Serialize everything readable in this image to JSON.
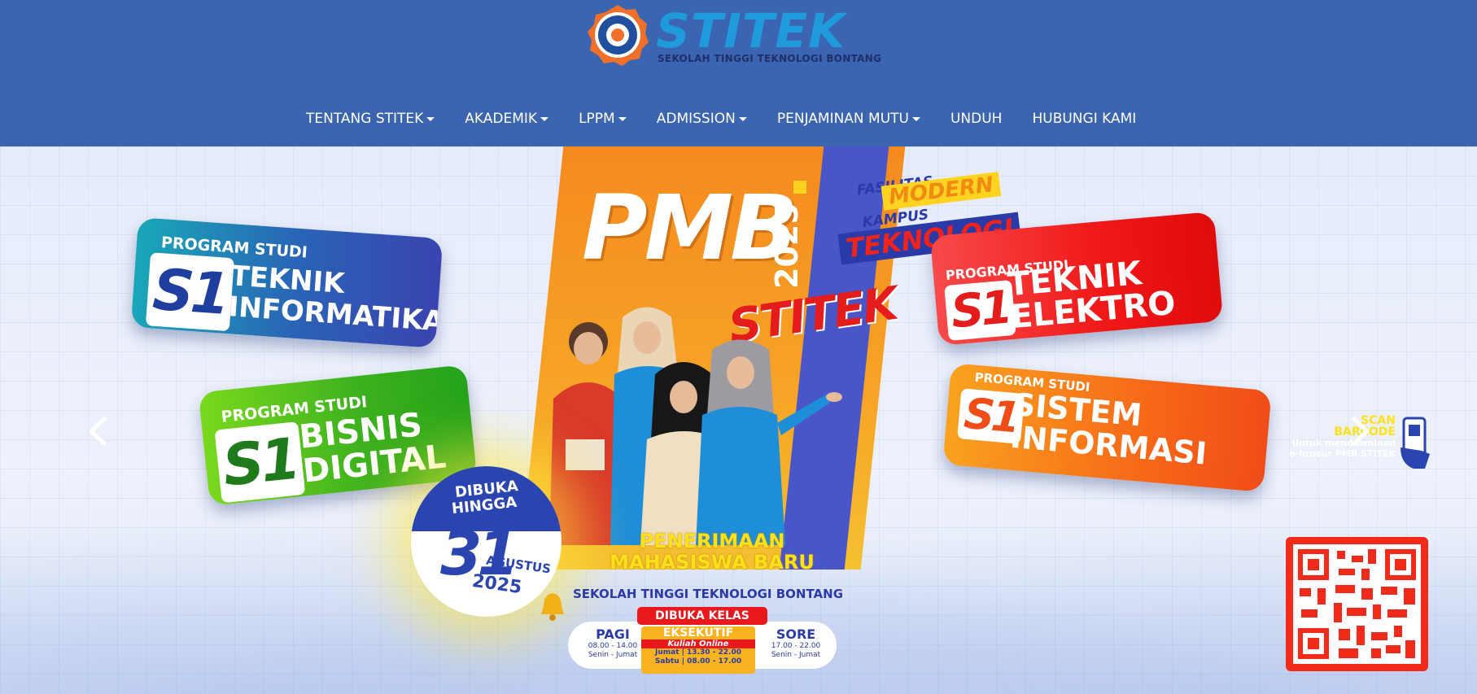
{
  "logo": {
    "wordmark": "STITEK",
    "tagline": "SEKOLAH TINGGI TEKNOLOGI BONTANG",
    "emblem_text": "SEKOLAH TINGGI TEKNOLOGI BONTANG"
  },
  "nav": {
    "items": [
      {
        "label": "TENTANG STITEK",
        "dropdown": true
      },
      {
        "label": "AKADEMIK",
        "dropdown": true
      },
      {
        "label": "LPPM",
        "dropdown": true
      },
      {
        "label": "ADMISSION",
        "dropdown": true
      },
      {
        "label": "PENJAMINAN MUTU",
        "dropdown": true
      },
      {
        "label": "UNDUH",
        "dropdown": false
      },
      {
        "label": "HUBUNGI KAMI",
        "dropdown": false
      }
    ]
  },
  "banner": {
    "headline": "PMB",
    "year": "2025",
    "brand": "STITEK",
    "tagline": {
      "line1": "FASILITAS",
      "highlight1": "MODERN",
      "line2": "KAMPUS",
      "highlight2": "TEKNOLOGI"
    },
    "programs": [
      {
        "prefix": "PROGRAM STUDI",
        "degree": "S1",
        "name_line1": "TEKNIK",
        "name_line2": "INFORMATIKA",
        "color": "#2a62b6"
      },
      {
        "prefix": "PROGRAM STUDI",
        "degree": "S1",
        "name_line1": "BISNIS",
        "name_line2": "DIGITAL",
        "color": "#3cb11e"
      },
      {
        "prefix": "PROGRAM STUDI",
        "degree": "S1",
        "name_line1": "TEKNIK",
        "name_line2": "ELEKTRO",
        "color": "#f01717"
      },
      {
        "prefix": "PROGRAM STUDI",
        "degree": "S1",
        "name_line1": "SISTEM",
        "name_line2": "INFORMASI",
        "color": "#f76a18"
      }
    ],
    "deadline": {
      "line1": "DIBUKA",
      "line2": "HINGGA",
      "day": "31",
      "month": "AGUSTUS",
      "year": "2025"
    },
    "admission": {
      "line1": "PENERIMAAN",
      "line2": "MAHASISWA BARU",
      "school": "SEKOLAH TINGGI TEKNOLOGI BONTANG"
    },
    "classes": {
      "header": "DIBUKA KELAS",
      "pagi": {
        "title": "PAGI",
        "time": "08.00 - 14.00",
        "days": "Senin - Jumat"
      },
      "eksekutif": {
        "title": "EKSEKUTIF",
        "note": "Kuliah Online",
        "time1": "Jumat | 13.30 - 22.00",
        "time2": "Sabtu | 08.00 - 17.00"
      },
      "sore": {
        "title": "SORE",
        "time": "17.00 - 22.00",
        "days": "Senin - Jumat"
      }
    },
    "scan": {
      "line1": "SCAN",
      "line2": "BARCODE",
      "sub1": "Untuk mendownload",
      "sub2": "e-brosur PMB STITEK"
    }
  },
  "carousel": {
    "prev_icon": "chevron-left-icon",
    "next_icon": "chevron-right-icon"
  },
  "colors": {
    "header_bg": "#3b65b0",
    "brand_blue": "#1f9bdc",
    "accent_orange": "#f58a1f",
    "accent_red": "#e8181d",
    "accent_yellow": "#ffe11a"
  }
}
